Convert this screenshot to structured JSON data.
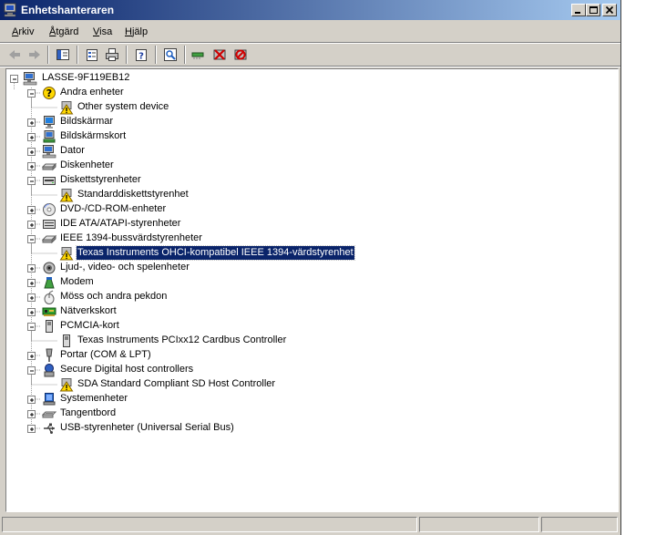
{
  "window": {
    "title": "Enhetshanteraren"
  },
  "menu": [
    {
      "key": "A",
      "rest": "rkiv"
    },
    {
      "key": "Å",
      "rest": "tgärd"
    },
    {
      "key": "V",
      "rest": "isa",
      "prefix": ""
    },
    {
      "key": "H",
      "rest": "jälp"
    }
  ],
  "menu_labels": [
    "Arkiv",
    "Åtgärd",
    "Visa",
    "Hjälp"
  ],
  "toolbar": {
    "icons": [
      "back-arrow-icon",
      "forward-arrow-icon",
      "show-hide-console-tree-icon",
      "properties-icon",
      "print-icon",
      "help-icon",
      "scan-hardware-icon",
      "update-driver-icon",
      "uninstall-icon",
      "disable-icon"
    ]
  },
  "tree": {
    "root": "LASSE-9F119EB12",
    "items": [
      {
        "label": "Andra enheter",
        "expanded": true,
        "icon": "question-device-icon"
      },
      {
        "label": "Other system device",
        "child": true,
        "icon": "warning-device-icon"
      },
      {
        "label": "Bildskärmar",
        "icon": "monitor-icon"
      },
      {
        "label": "Bildskärmskort",
        "icon": "display-adapter-icon"
      },
      {
        "label": "Dator",
        "icon": "computer-icon"
      },
      {
        "label": "Diskenheter",
        "icon": "disk-drive-icon"
      },
      {
        "label": "Diskettstyrenheter",
        "expanded": true,
        "icon": "floppy-controller-icon"
      },
      {
        "label": "Standarddiskettstyrenhet",
        "child": true,
        "icon": "warning-device-icon"
      },
      {
        "label": "DVD-/CD-ROM-enheter",
        "icon": "cdrom-icon"
      },
      {
        "label": "IDE ATA/ATAPI-styrenheter",
        "icon": "ide-controller-icon"
      },
      {
        "label": "IEEE 1394-bussvärdstyrenheter",
        "expanded": true,
        "icon": "ieee1394-icon"
      },
      {
        "label": "Texas Instruments OHCI-kompatibel IEEE 1394-värdstyrenhet",
        "child": true,
        "selected": true,
        "icon": "warning-device-icon"
      },
      {
        "label": "Ljud-, video- och spelenheter",
        "icon": "sound-icon"
      },
      {
        "label": "Modem",
        "icon": "modem-icon"
      },
      {
        "label": "Möss och andra pekdon",
        "icon": "mouse-icon"
      },
      {
        "label": "Nätverkskort",
        "icon": "network-card-icon"
      },
      {
        "label": "PCMCIA-kort",
        "expanded": true,
        "icon": "pcmcia-icon"
      },
      {
        "label": "Texas Instruments PCIxx12 Cardbus Controller",
        "child": true,
        "icon": "pcmcia-icon"
      },
      {
        "label": "Portar (COM & LPT)",
        "icon": "port-icon"
      },
      {
        "label": "Secure Digital host controllers",
        "expanded": true,
        "icon": "sd-host-icon"
      },
      {
        "label": "SDA Standard Compliant SD Host Controller",
        "child": true,
        "icon": "warning-device-icon"
      },
      {
        "label": "Systemenheter",
        "icon": "system-device-icon"
      },
      {
        "label": "Tangentbord",
        "icon": "keyboard-icon"
      },
      {
        "label": "USB-styrenheter (Universal Serial Bus)",
        "icon": "usb-icon"
      }
    ]
  },
  "colors": {
    "title_start": "#0a246a",
    "title_end": "#a6caf0",
    "selection": "#0a246a",
    "face": "#d4d0c8",
    "warning": "#ffd800"
  }
}
